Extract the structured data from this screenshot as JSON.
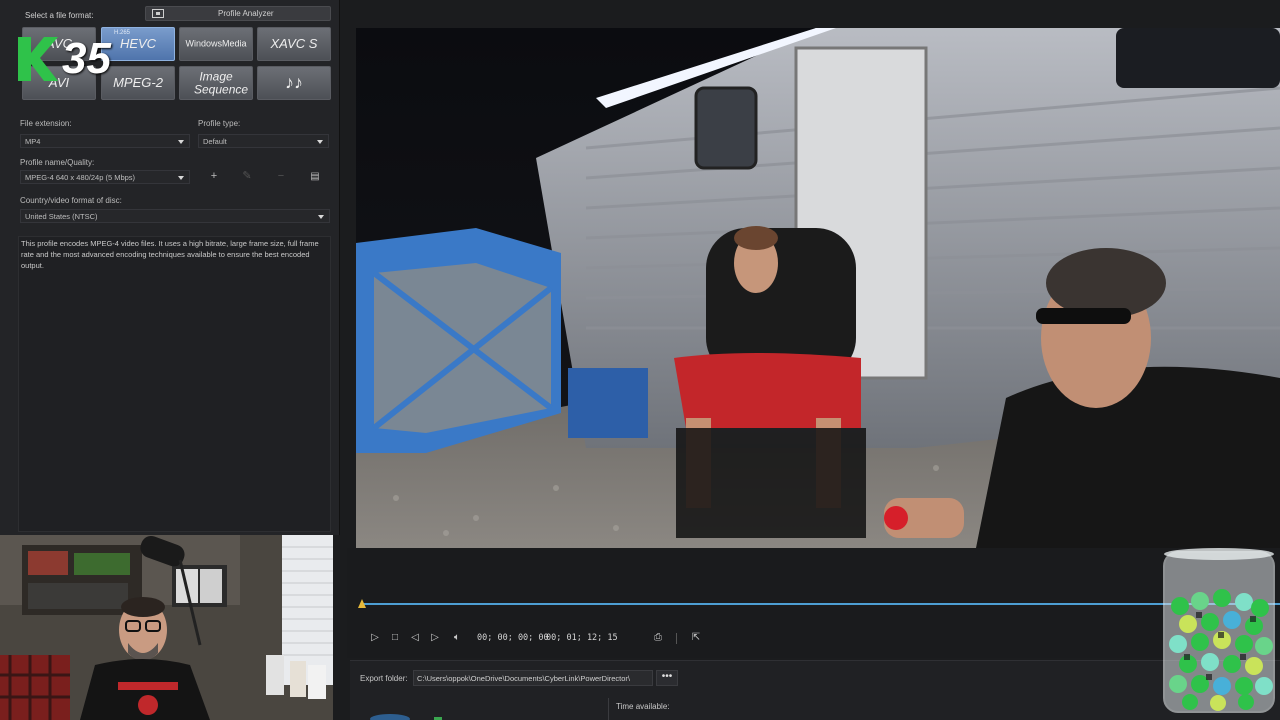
{
  "format_panel": {
    "title": "Select a file format:",
    "profile_analyzer_label": "Profile Analyzer",
    "formats": [
      {
        "label": "AVC",
        "selected": false
      },
      {
        "label": "HEVC",
        "superscript": "H.265",
        "selected": true
      },
      {
        "label": "WindowsMedia",
        "selected": false
      },
      {
        "label": "XAVC S",
        "selected": false
      },
      {
        "label": "AVI",
        "selected": false
      },
      {
        "label": "MPEG-2",
        "selected": false
      },
      {
        "label": "Image Sequence",
        "selected": false
      },
      {
        "label": "♪♪",
        "icon": "music-notes-icon",
        "selected": false
      }
    ]
  },
  "settings": {
    "file_extension_label": "File extension:",
    "file_extension_value": "MP4",
    "profile_type_label": "Profile type:",
    "profile_type_value": "Default",
    "profile_name_label": "Profile name/Quality:",
    "profile_name_value": "MPEG-4 640 x 480/24p (5 Mbps)",
    "country_label": "Country/video format of disc:",
    "country_value": "United States (NTSC)",
    "description": "This profile encodes MPEG-4 video files. It uses a high bitrate, large frame size, full frame rate and the most advanced encoding techniques available to ensure the best encoded output."
  },
  "logo": {
    "text": "35",
    "accent": "#2fc24a"
  },
  "player": {
    "current_time": "00; 00; 00; 00",
    "total_time": "00; 01; 12; 15",
    "timeline_color": "#4d9ed3"
  },
  "export": {
    "folder_label": "Export folder:",
    "folder_path": "C:\\Users\\oppok\\OneDrive\\Documents\\CyberLink\\PowerDirector\\",
    "browse_label": "•••",
    "time_available_label": "Time available:"
  },
  "colors": {
    "selected_format": "#5e84bf",
    "format_button": "#5c5f66",
    "panel_bg": "#232427"
  }
}
